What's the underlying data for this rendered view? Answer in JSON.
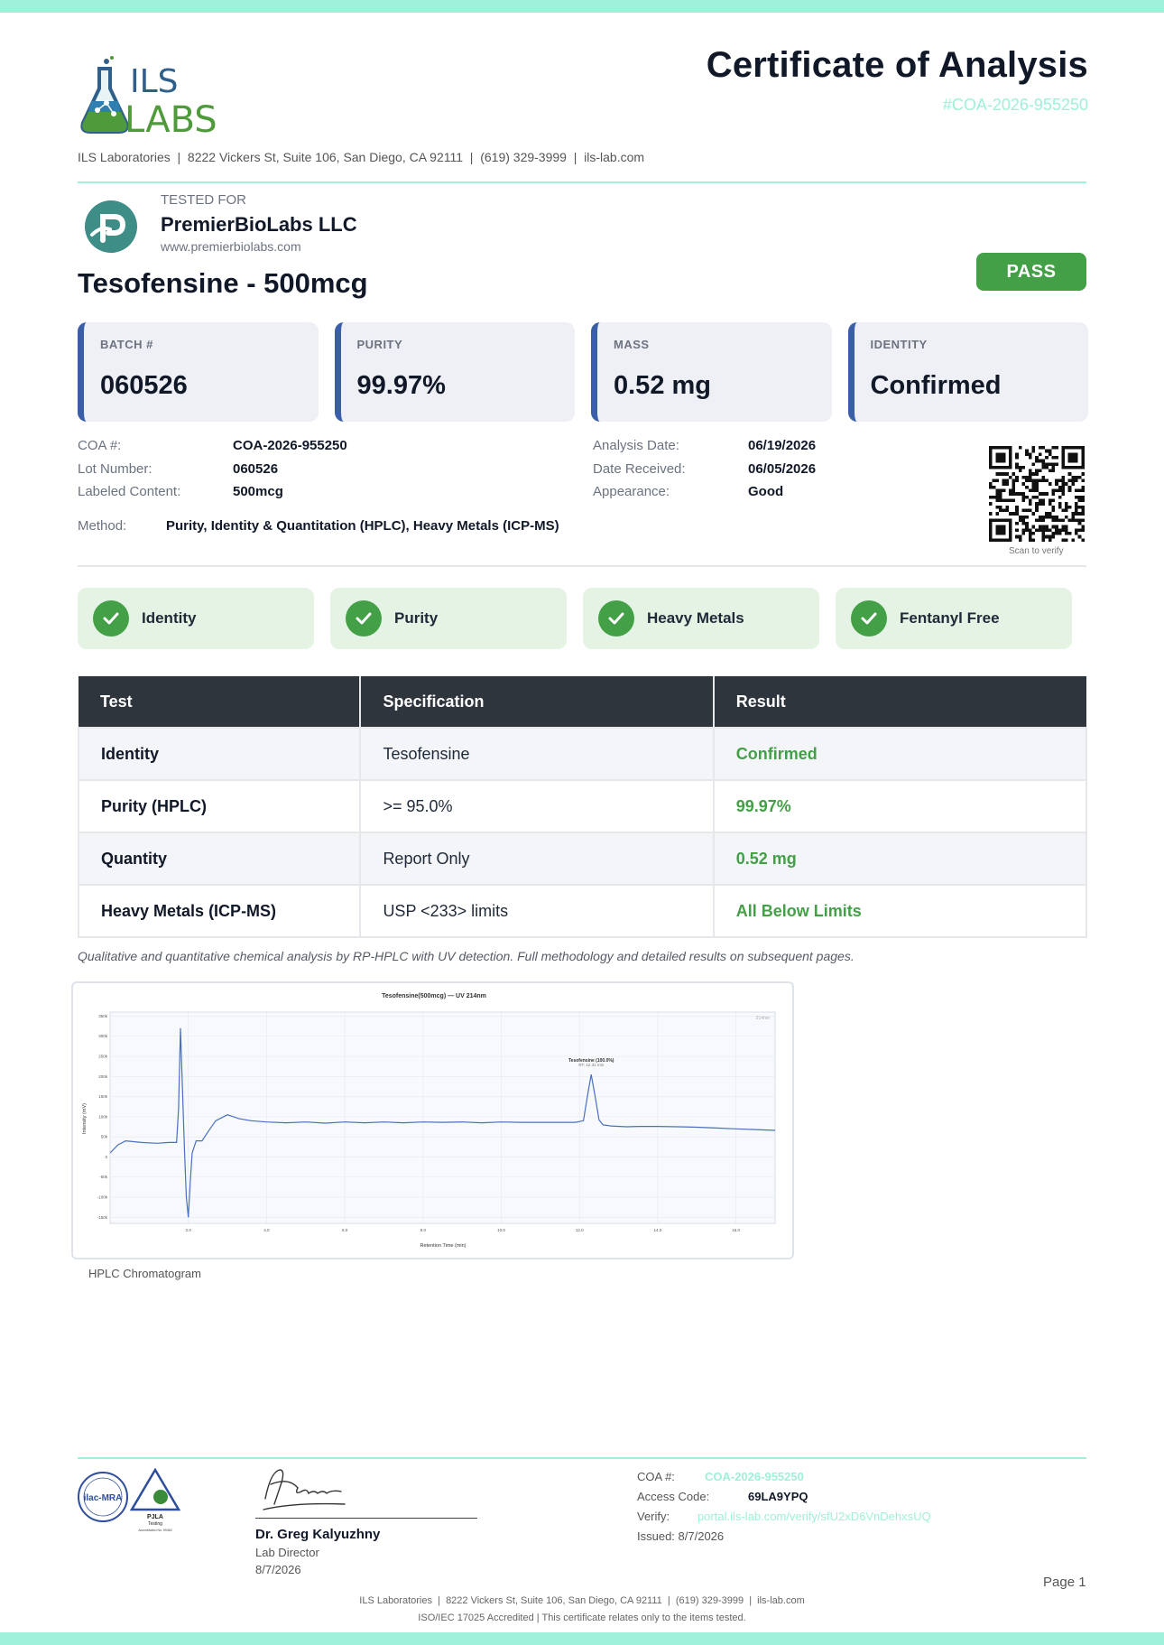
{
  "header": {
    "title": "Certificate of Analysis",
    "coa_id": "#COA-2026-955250",
    "lab_info": "ILS Laboratories  |  8222 Vickers St, Suite 106, San Diego, CA 92111  |  (619) 329-3999  |  ils-lab.com",
    "logo_top": "ILS",
    "logo_bottom": "LABS"
  },
  "client": {
    "tested_for_label": "TESTED FOR",
    "name": "PremierBioLabs LLC",
    "website": "www.premierbiolabs.com"
  },
  "product": {
    "name": "Tesofensine - 500mcg",
    "status": "PASS"
  },
  "summary_cards": [
    {
      "label": "BATCH #",
      "value": "060526"
    },
    {
      "label": "PURITY",
      "value": "99.97%"
    },
    {
      "label": "MASS",
      "value": "0.52 mg"
    },
    {
      "label": "IDENTITY",
      "value": "Confirmed"
    }
  ],
  "details": {
    "coa_label": "COA #:",
    "coa_value": "COA-2026-955250",
    "lot_label": "Lot Number:",
    "lot_value": "060526",
    "labeled_label": "Labeled Content:",
    "labeled_value": "500mcg",
    "analysis_label": "Analysis Date:",
    "analysis_value": "06/19/2026",
    "received_label": "Date Received:",
    "received_value": "06/05/2026",
    "appearance_label": "Appearance:",
    "appearance_value": "Good",
    "method_label": "Method:",
    "method_value": "Purity, Identity & Quantitation (HPLC), Heavy Metals (ICP-MS)",
    "scan_label": "Scan to verify"
  },
  "checks": [
    "Identity",
    "Purity",
    "Heavy Metals",
    "Fentanyl Free"
  ],
  "results_table": {
    "headers": [
      "Test",
      "Specification",
      "Result"
    ],
    "rows": [
      {
        "test": "Identity",
        "spec": "Tesofensine",
        "result": "Confirmed"
      },
      {
        "test": "Purity (HPLC)",
        "spec": ">= 95.0%",
        "result": "99.97%"
      },
      {
        "test": "Quantity",
        "spec": "Report Only",
        "result": "0.52 mg"
      },
      {
        "test": "Heavy Metals (ICP-MS)",
        "spec": "USP <233> limits",
        "result": "All Below Limits"
      }
    ],
    "note": "Qualitative and quantitative chemical analysis by RP-HPLC with UV detection. Full methodology and detailed results on subsequent pages."
  },
  "chart_data": {
    "type": "line",
    "title": "Tesofensine(500mcg) — UV 214nm",
    "xlabel": "Retention Time (min)",
    "ylabel": "Intensity (mV)",
    "xlim": [
      0,
      17.0
    ],
    "ylim": [
      -165000,
      360000
    ],
    "x_ticks": [
      2.0,
      4.0,
      6.0,
      8.0,
      10.0,
      12.0,
      14.0,
      16.0
    ],
    "y_ticks": [
      -150000,
      -100000,
      -50000,
      0,
      50000,
      100000,
      150000,
      200000,
      250000,
      300000,
      350000
    ],
    "x_tick_labels": [
      "2.0",
      "4.0",
      "6.0",
      "8.0",
      "10.0",
      "12.0",
      "14.0",
      "16.0"
    ],
    "y_tick_labels": [
      "-150k",
      "-100k",
      "-50k",
      "0",
      "50k",
      "100k",
      "150k",
      "200k",
      "250k",
      "300k",
      "350k"
    ],
    "corner_label": "214nm",
    "annotations": [
      {
        "x": 12.3,
        "y": 205000,
        "text": "Tesofensine (100.0%)",
        "subtext": "RT: 12.31 min"
      }
    ],
    "series": [
      {
        "color": "#4a6fc1",
        "x": [
          0.0,
          0.2,
          0.4,
          0.8,
          1.2,
          1.5,
          1.7,
          1.75,
          1.8,
          1.85,
          1.9,
          1.95,
          2.0,
          2.05,
          2.1,
          2.2,
          2.35,
          2.5,
          2.7,
          3.0,
          3.3,
          3.6,
          4.0,
          4.5,
          5.0,
          5.5,
          6.0,
          6.5,
          7.0,
          7.5,
          8.0,
          8.5,
          9.0,
          9.5,
          10.0,
          10.5,
          11.0,
          11.5,
          11.9,
          12.1,
          12.2,
          12.3,
          12.4,
          12.5,
          12.6,
          12.8,
          13.2,
          13.5,
          14.0,
          14.5,
          15.0,
          15.5,
          16.0,
          16.5,
          17.0
        ],
        "y": [
          10000,
          30000,
          40000,
          36000,
          34000,
          36000,
          36000,
          120000,
          320000,
          170000,
          20000,
          -100000,
          -150000,
          -60000,
          10000,
          40000,
          40000,
          62000,
          90000,
          105000,
          95000,
          90000,
          87000,
          85000,
          87000,
          84000,
          87000,
          85000,
          87000,
          85000,
          87000,
          86000,
          87000,
          85000,
          87000,
          86000,
          86000,
          86000,
          86000,
          90000,
          150000,
          205000,
          150000,
          92000,
          80000,
          77000,
          75000,
          76000,
          76000,
          75000,
          74000,
          72000,
          70000,
          68000,
          66000
        ]
      }
    ]
  },
  "chromatogram_caption": "HPLC Chromatogram",
  "footer": {
    "signatory_name": "Dr. Greg Kalyuzhny",
    "signatory_title": "Lab Director",
    "signatory_date": "8/7/2026",
    "accred_pjla": "PJLA",
    "accred_pjla_sub": "Testing",
    "accred_pjla_no": "Accreditation No. 99462",
    "accred_ilac": "ilac-MRA",
    "coa_label": "COA #:",
    "coa_value": "COA-2026-955250",
    "access_label": "Access Code:",
    "access_value": "69LA9YPQ",
    "verify_label": "Verify:",
    "verify_value": "portal.ils-lab.com/verify/sfU2xD6VnDehxsUQ",
    "issued": "Issued: 8/7/2026",
    "page": "Page 1",
    "line1": "ILS Laboratories  |  8222 Vickers St, Suite 106, San Diego, CA 92111  |  (619) 329-3999  |  ils-lab.com",
    "line2": "ISO/IEC 17025 Accredited  |  This certificate relates only to the items tested."
  },
  "colors": {
    "accent_teal": "#9ff0d9",
    "pass_green": "#43a047",
    "card_blue": "#3b5ea8",
    "table_header": "#2f353d",
    "line_blue": "#4a6fc1"
  }
}
